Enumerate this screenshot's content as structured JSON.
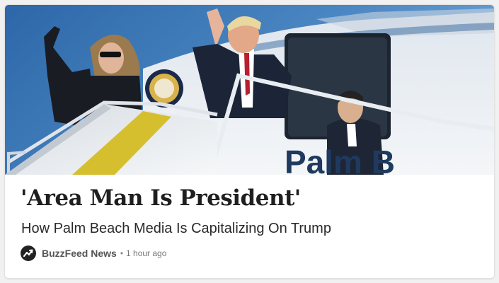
{
  "article": {
    "headline": "'Area Man Is President'",
    "dek": "How Palm Beach Media Is Capitalizing On Trump",
    "source": "BuzzFeed News",
    "separator": "•",
    "timestamp": "1 hour ago",
    "plane_lettering": "Palm B",
    "source_icon": "buzzfeed-trending-arrow-icon"
  },
  "colors": {
    "sky": "#3f78b4",
    "plane_white": "#e9edf1",
    "stair_stripe": "#d6bf2f",
    "headline_text": "#1f1f1f",
    "logo_bg": "#222222"
  }
}
